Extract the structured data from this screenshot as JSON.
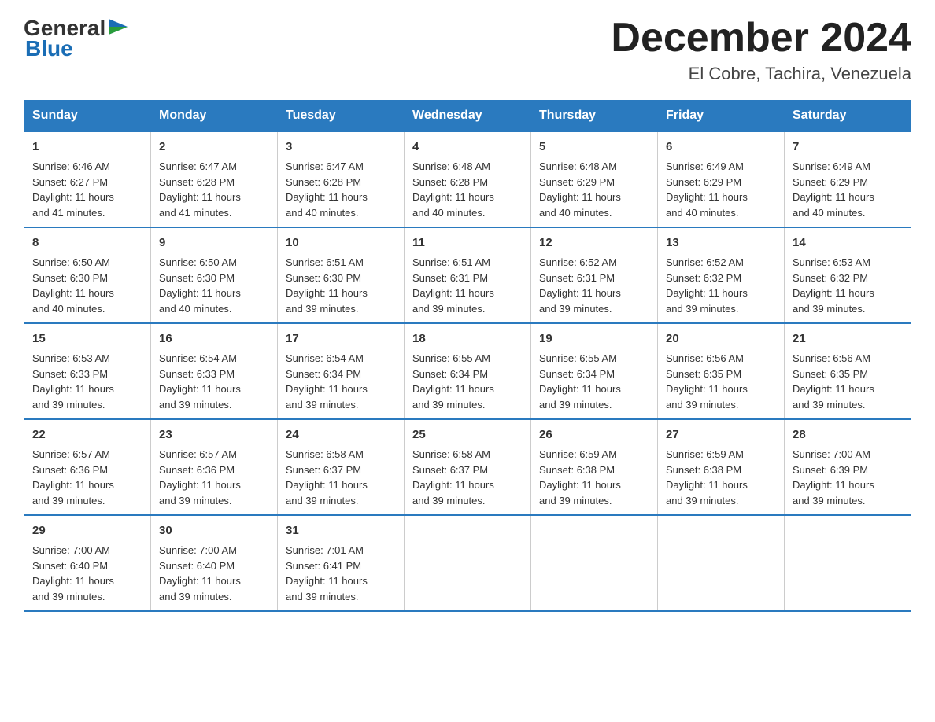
{
  "header": {
    "logo_text_general": "General",
    "logo_text_blue": "Blue",
    "month_title": "December 2024",
    "location": "El Cobre, Tachira, Venezuela"
  },
  "days_of_week": [
    "Sunday",
    "Monday",
    "Tuesday",
    "Wednesday",
    "Thursday",
    "Friday",
    "Saturday"
  ],
  "weeks": [
    [
      {
        "day": "1",
        "sunrise": "6:46 AM",
        "sunset": "6:27 PM",
        "daylight": "11 hours and 41 minutes."
      },
      {
        "day": "2",
        "sunrise": "6:47 AM",
        "sunset": "6:28 PM",
        "daylight": "11 hours and 41 minutes."
      },
      {
        "day": "3",
        "sunrise": "6:47 AM",
        "sunset": "6:28 PM",
        "daylight": "11 hours and 40 minutes."
      },
      {
        "day": "4",
        "sunrise": "6:48 AM",
        "sunset": "6:28 PM",
        "daylight": "11 hours and 40 minutes."
      },
      {
        "day": "5",
        "sunrise": "6:48 AM",
        "sunset": "6:29 PM",
        "daylight": "11 hours and 40 minutes."
      },
      {
        "day": "6",
        "sunrise": "6:49 AM",
        "sunset": "6:29 PM",
        "daylight": "11 hours and 40 minutes."
      },
      {
        "day": "7",
        "sunrise": "6:49 AM",
        "sunset": "6:29 PM",
        "daylight": "11 hours and 40 minutes."
      }
    ],
    [
      {
        "day": "8",
        "sunrise": "6:50 AM",
        "sunset": "6:30 PM",
        "daylight": "11 hours and 40 minutes."
      },
      {
        "day": "9",
        "sunrise": "6:50 AM",
        "sunset": "6:30 PM",
        "daylight": "11 hours and 40 minutes."
      },
      {
        "day": "10",
        "sunrise": "6:51 AM",
        "sunset": "6:30 PM",
        "daylight": "11 hours and 39 minutes."
      },
      {
        "day": "11",
        "sunrise": "6:51 AM",
        "sunset": "6:31 PM",
        "daylight": "11 hours and 39 minutes."
      },
      {
        "day": "12",
        "sunrise": "6:52 AM",
        "sunset": "6:31 PM",
        "daylight": "11 hours and 39 minutes."
      },
      {
        "day": "13",
        "sunrise": "6:52 AM",
        "sunset": "6:32 PM",
        "daylight": "11 hours and 39 minutes."
      },
      {
        "day": "14",
        "sunrise": "6:53 AM",
        "sunset": "6:32 PM",
        "daylight": "11 hours and 39 minutes."
      }
    ],
    [
      {
        "day": "15",
        "sunrise": "6:53 AM",
        "sunset": "6:33 PM",
        "daylight": "11 hours and 39 minutes."
      },
      {
        "day": "16",
        "sunrise": "6:54 AM",
        "sunset": "6:33 PM",
        "daylight": "11 hours and 39 minutes."
      },
      {
        "day": "17",
        "sunrise": "6:54 AM",
        "sunset": "6:34 PM",
        "daylight": "11 hours and 39 minutes."
      },
      {
        "day": "18",
        "sunrise": "6:55 AM",
        "sunset": "6:34 PM",
        "daylight": "11 hours and 39 minutes."
      },
      {
        "day": "19",
        "sunrise": "6:55 AM",
        "sunset": "6:34 PM",
        "daylight": "11 hours and 39 minutes."
      },
      {
        "day": "20",
        "sunrise": "6:56 AM",
        "sunset": "6:35 PM",
        "daylight": "11 hours and 39 minutes."
      },
      {
        "day": "21",
        "sunrise": "6:56 AM",
        "sunset": "6:35 PM",
        "daylight": "11 hours and 39 minutes."
      }
    ],
    [
      {
        "day": "22",
        "sunrise": "6:57 AM",
        "sunset": "6:36 PM",
        "daylight": "11 hours and 39 minutes."
      },
      {
        "day": "23",
        "sunrise": "6:57 AM",
        "sunset": "6:36 PM",
        "daylight": "11 hours and 39 minutes."
      },
      {
        "day": "24",
        "sunrise": "6:58 AM",
        "sunset": "6:37 PM",
        "daylight": "11 hours and 39 minutes."
      },
      {
        "day": "25",
        "sunrise": "6:58 AM",
        "sunset": "6:37 PM",
        "daylight": "11 hours and 39 minutes."
      },
      {
        "day": "26",
        "sunrise": "6:59 AM",
        "sunset": "6:38 PM",
        "daylight": "11 hours and 39 minutes."
      },
      {
        "day": "27",
        "sunrise": "6:59 AM",
        "sunset": "6:38 PM",
        "daylight": "11 hours and 39 minutes."
      },
      {
        "day": "28",
        "sunrise": "7:00 AM",
        "sunset": "6:39 PM",
        "daylight": "11 hours and 39 minutes."
      }
    ],
    [
      {
        "day": "29",
        "sunrise": "7:00 AM",
        "sunset": "6:40 PM",
        "daylight": "11 hours and 39 minutes."
      },
      {
        "day": "30",
        "sunrise": "7:00 AM",
        "sunset": "6:40 PM",
        "daylight": "11 hours and 39 minutes."
      },
      {
        "day": "31",
        "sunrise": "7:01 AM",
        "sunset": "6:41 PM",
        "daylight": "11 hours and 39 minutes."
      },
      null,
      null,
      null,
      null
    ]
  ],
  "labels": {
    "sunrise": "Sunrise:",
    "sunset": "Sunset:",
    "daylight": "Daylight:"
  }
}
